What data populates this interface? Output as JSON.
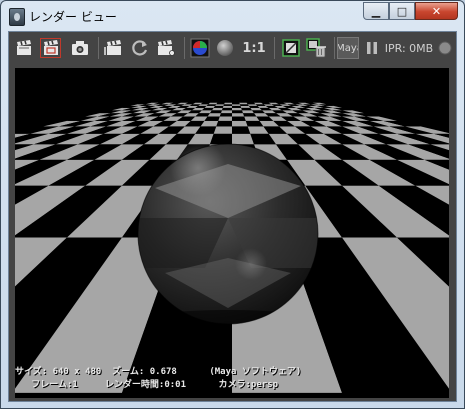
{
  "window": {
    "title": "レンダー ビュー",
    "minimize_glyph": "▁",
    "maximize_glyph": "□",
    "close_glyph": "✕"
  },
  "toolbar": {
    "items": [
      "clapboard-icon",
      "clapboard-region-icon",
      "camera-snapshot-icon",
      "clapboard-ipr-icon",
      "refresh-icon",
      "clapboard-options-icon",
      "rgb-channel-icon",
      "alpha-channel-icon",
      "display-frame-icon",
      "keep-image-icon"
    ],
    "ratio_label": "1:1",
    "maya_button_label": "Maya",
    "ipr_memory": "IPR: 0MB",
    "colors": {
      "background": "#444444",
      "accent_red": "#c0392b",
      "accent_green": "#4caf50"
    }
  },
  "render": {
    "scene": "checkerboard-floor-with-reflective-sphere",
    "info_line1": "サイズ: 640 x 480  ズーム: 0.678      (Maya ソフトウェア)",
    "info_line2": "   フレーム:1     レンダー時間:0:01      カメラ:persp"
  }
}
